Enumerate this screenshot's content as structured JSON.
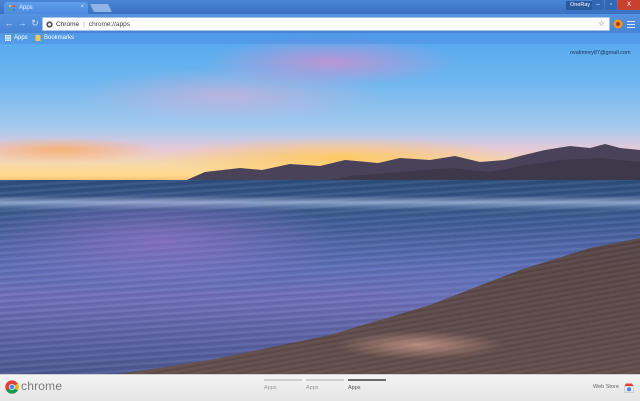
{
  "tab": {
    "title": "Apps",
    "close": "×"
  },
  "window": {
    "profile_label": "OneRay",
    "minimize": "–",
    "maximize": "▫",
    "close": "X"
  },
  "toolbar": {
    "back": "←",
    "forward": "→",
    "reload": "↻",
    "site_chip": "Chrome",
    "url": "chrome://apps",
    "star": "☆"
  },
  "bookmarks_bar": {
    "items": [
      {
        "label": "Apps",
        "icon": "apps-grid-icon"
      },
      {
        "label": "Bookmarks",
        "icon": "folder-icon"
      }
    ]
  },
  "account": {
    "email": "ovatimrey87@gmail.com"
  },
  "bottom_bar": {
    "brand": "chrome",
    "pages": [
      {
        "label": "Apps",
        "active": false
      },
      {
        "label": "Apps",
        "active": false
      },
      {
        "label": "Apps",
        "active": true
      }
    ],
    "webstore_label": "Web Store"
  },
  "colors": {
    "tabstrip": "#3a70c0",
    "toolbar": "#4784d6",
    "close_button": "#c8412f",
    "bottom_bar": "#ececec"
  }
}
